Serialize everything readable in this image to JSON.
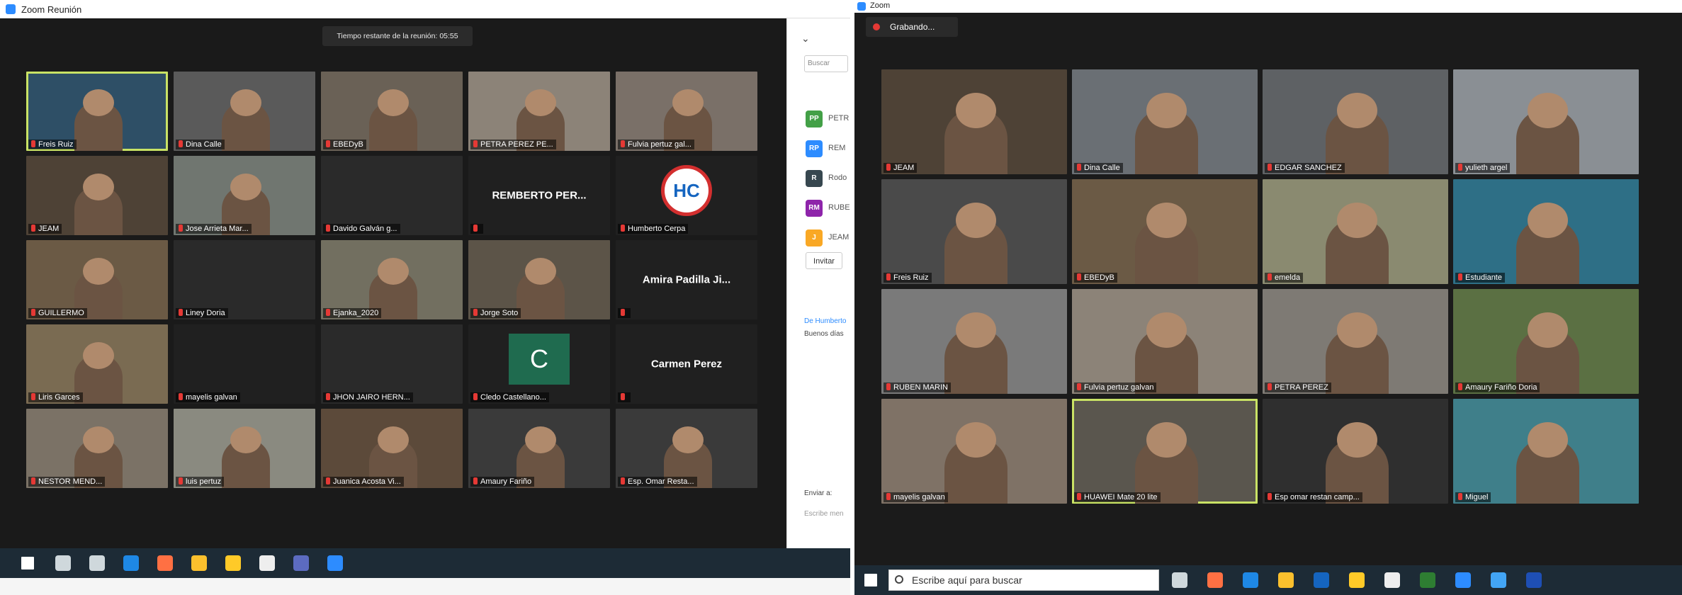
{
  "left": {
    "window_title": "Zoom Reunión",
    "timer_text": "Tiempo restante de la reunión: 05:55",
    "tiles": [
      {
        "name": "Freis Ruiz",
        "active": true,
        "bg": "#2e4f66"
      },
      {
        "name": "Dina Calle",
        "bg": "#5a5a5a"
      },
      {
        "name": "EBEDyB",
        "bg": "#6a6156"
      },
      {
        "name": "PETRA PEREZ PE...",
        "bg": "#8c8378"
      },
      {
        "name": "Fulvia pertuz gal...",
        "bg": "#7a7068"
      },
      {
        "name": "JEAM",
        "bg": "#4e4236"
      },
      {
        "name": "Jose Arrieta Mar...",
        "bg": "#707670"
      },
      {
        "name": "Davido Galván g...",
        "bg": "#2a2a2a"
      },
      {
        "name": "",
        "big": "REMBERTO PER...",
        "bg": "#202020"
      },
      {
        "name": "Humberto Cerpa",
        "logo": "HC",
        "bg": "#202020"
      },
      {
        "name": "GUILLERMO",
        "bg": "#6b5a45"
      },
      {
        "name": "Liney Doria",
        "bg": "#2a2a2a"
      },
      {
        "name": "Ejanka_2020",
        "bg": "#726f60"
      },
      {
        "name": "Jorge Soto",
        "bg": "#5c5448"
      },
      {
        "name": "",
        "big": "Amira Padilla Ji...",
        "bg": "#202020"
      },
      {
        "name": "Liris Garces",
        "bg": "#7a6b52"
      },
      {
        "name": "mayelis galvan",
        "bg": "#202020"
      },
      {
        "name": "JHON JAIRO HERN...",
        "bg": "#2a2a2a"
      },
      {
        "name": "Cledo Castellano...",
        "letter": "C",
        "bg": "#202020"
      },
      {
        "name": "",
        "big": "Carmen Perez",
        "bg": "#202020"
      },
      {
        "name": "NESTOR MEND...",
        "bg": "#7b7266"
      },
      {
        "name": "luis pertuz",
        "bg": "#8a8a80"
      },
      {
        "name": "Juanica Acosta Vi...",
        "bg": "#5c4a3a"
      },
      {
        "name": "Amaury Fariño",
        "bg": "#3a3a3a"
      },
      {
        "name": "Esp. Omar Resta...",
        "bg": "#3a3a3a"
      }
    ],
    "side_panel": {
      "chevron": "⌄",
      "search_placeholder": "Buscar",
      "participants": [
        {
          "initials": "PP",
          "label": "PETR",
          "color": "#43a047"
        },
        {
          "initials": "RP",
          "label": "REM",
          "color": "#2d8cff"
        },
        {
          "initials": "R",
          "label": "Rodo",
          "color": "#37474f"
        },
        {
          "initials": "RM",
          "label": "RUBE",
          "color": "#8e24aa"
        },
        {
          "initials": "J",
          "label": "JEAM",
          "color": "#f9a825"
        }
      ],
      "invite_label": "Invitar",
      "chat_from": "De Humberto",
      "chat_message": "Buenos días",
      "send_to_label": "Enviar a:",
      "write_placeholder": "Escribe men"
    }
  },
  "right": {
    "window_title": "Zoom",
    "recording_label": "Grabando...",
    "tiles": [
      {
        "name": "JEAM",
        "bg": "#4e4236"
      },
      {
        "name": "Dina Calle",
        "bg": "#6a6f74"
      },
      {
        "name": "EDGAR SANCHEZ",
        "bg": "#5e6164"
      },
      {
        "name": "yulieth argel",
        "bg": "#8a8f94"
      },
      {
        "name": "Freis Ruiz",
        "bg": "#4a4a4a"
      },
      {
        "name": "EBEDyB",
        "bg": "#6b5a45"
      },
      {
        "name": "emelda",
        "bg": "#8a8a70"
      },
      {
        "name": "Estudiante",
        "bg": "#2e6f86"
      },
      {
        "name": "RUBEN MARIN",
        "bg": "#7a7a7a"
      },
      {
        "name": "Fulvia pertuz galvan",
        "bg": "#8c8378"
      },
      {
        "name": "PETRA PEREZ",
        "bg": "#7e7a74"
      },
      {
        "name": "Amaury Fariño Doria",
        "bg": "#5b7043"
      },
      {
        "name": "mayelis galvan",
        "bg": "#7f7266"
      },
      {
        "name": "HUAWEI Mate 20 lite",
        "active": true,
        "bg": "#5a564e"
      },
      {
        "name": "Esp omar restan camp...",
        "bg": "#2f2f2f"
      },
      {
        "name": "Miguel",
        "bg": "#3f7f8a"
      }
    ],
    "taskbar_search": "Escribe aquí para buscar"
  },
  "colors": {
    "active_outline": "#c9e265",
    "mic_muted": "#e53935",
    "taskbar": "#1d2b36",
    "zoom_blue": "#2d8cff"
  },
  "taskbar_icons_left": [
    "windows-icon",
    "search-icon",
    "task-view-icon",
    "edge-icon",
    "firefox-icon",
    "chrome-icon",
    "file-explorer-icon",
    "store-icon",
    "save-icon",
    "zoom-icon"
  ],
  "taskbar_icons_right": [
    "windows-icon",
    "task-view-icon",
    "firefox-icon",
    "edge-icon",
    "chrome-icon",
    "mail-icon",
    "file-explorer-icon",
    "store-icon",
    "excel-icon",
    "zoom-icon",
    "photos-icon",
    "word-icon"
  ]
}
